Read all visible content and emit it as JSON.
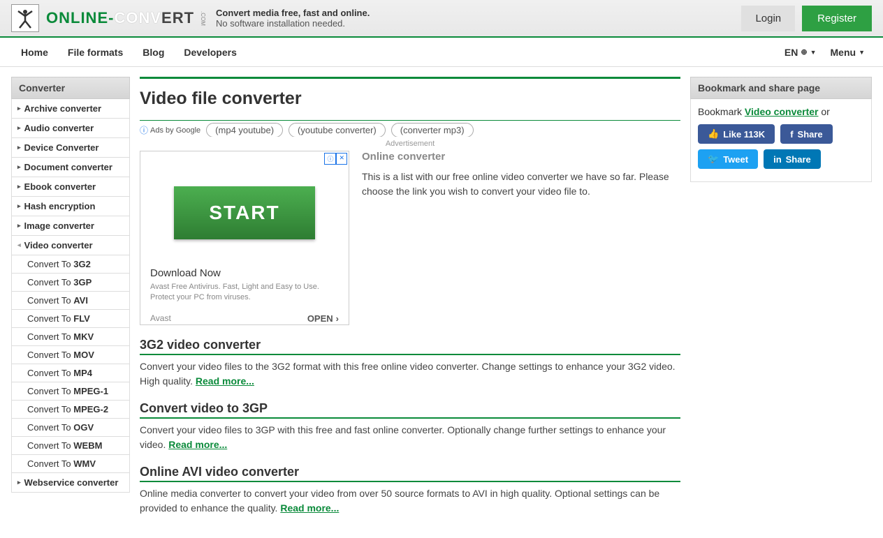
{
  "header": {
    "logo_text_1": "ONLINE-",
    "logo_text_2": "CONV",
    "logo_text_3": "ERT",
    "logo_sub": ".COM",
    "tagline1": "Convert media free, fast and online.",
    "tagline2": "No software installation needed.",
    "login": "Login",
    "register": "Register"
  },
  "nav": {
    "home": "Home",
    "file_formats": "File formats",
    "blog": "Blog",
    "developers": "Developers",
    "lang": "EN",
    "menu": "Menu"
  },
  "sidebar": {
    "header": "Converter",
    "items": [
      "Archive converter",
      "Audio converter",
      "Device Converter",
      "Document converter",
      "Ebook converter",
      "Hash encryption",
      "Image converter",
      "Video converter",
      "Webservice converter"
    ],
    "subs": [
      {
        "pre": "Convert To ",
        "fmt": "3G2"
      },
      {
        "pre": "Convert To ",
        "fmt": "3GP"
      },
      {
        "pre": "Convert To ",
        "fmt": "AVI"
      },
      {
        "pre": "Convert To ",
        "fmt": "FLV"
      },
      {
        "pre": "Convert To ",
        "fmt": "MKV"
      },
      {
        "pre": "Convert To ",
        "fmt": "MOV"
      },
      {
        "pre": "Convert To ",
        "fmt": "MP4"
      },
      {
        "pre": "Convert To ",
        "fmt": "MPEG-1"
      },
      {
        "pre": "Convert To ",
        "fmt": "MPEG-2"
      },
      {
        "pre": "Convert To ",
        "fmt": "OGV"
      },
      {
        "pre": "Convert To ",
        "fmt": "WEBM"
      },
      {
        "pre": "Convert To ",
        "fmt": "WMV"
      }
    ]
  },
  "main": {
    "title": "Video file converter",
    "ads_label": "Ads by Google",
    "ad_links": [
      "mp4 youtube",
      "(youtube converter)",
      "converter mp3"
    ],
    "ad_label": "Advertisement",
    "ad": {
      "start": "START",
      "dl": "Download Now",
      "desc": "Avast Free Antivirus. Fast, Light and Easy to Use. Protect your PC from viruses.",
      "brand": "Avast",
      "open": "OPEN"
    },
    "intro_title": "Online converter",
    "intro_text": "This is a list with our free online video converter we have so far. Please choose the link you wish to convert your video file to.",
    "converters": [
      {
        "title": "3G2 video converter",
        "desc": "Convert your video files to the 3G2 format with this free online video converter. Change settings to enhance your 3G2 video. High quality. ",
        "more": "Read more..."
      },
      {
        "title": "Convert video to 3GP",
        "desc": "Convert your video files to 3GP with this free and fast online converter. Optionally change further settings to enhance your video. ",
        "more": "Read more..."
      },
      {
        "title": "Online AVI video converter",
        "desc": "Online media converter to convert your video from over 50 source formats to AVI in high quality. Optional settings can be provided to enhance the quality. ",
        "more": "Read more..."
      }
    ]
  },
  "right": {
    "header": "Bookmark and share page",
    "bookmark_pre": "Bookmark ",
    "bookmark_link": "Video converter",
    "bookmark_post": " or",
    "like": "Like 113K",
    "share": "Share",
    "tweet": "Tweet",
    "li_share": "Share"
  }
}
